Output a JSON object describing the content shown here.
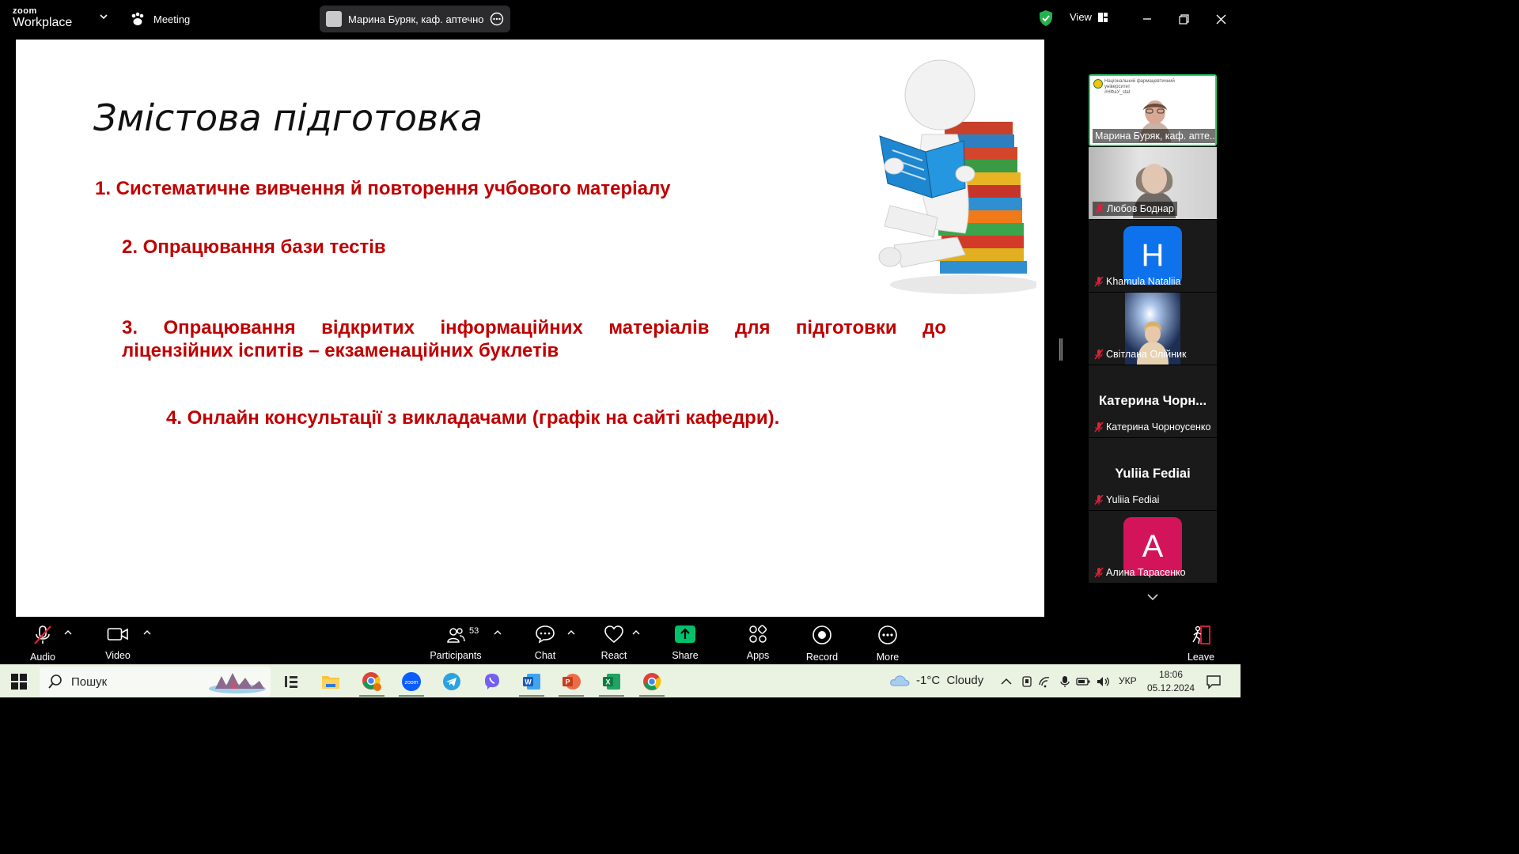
{
  "app": {
    "brand_line1": "zoom",
    "brand_line2": "Workplace",
    "meeting_label": "Meeting",
    "active_speaker": "Марина Буряк, каф. аптечної те",
    "view_label": "View",
    "security_color": "#22b14c"
  },
  "slide": {
    "title": "Змістова підготовка",
    "points": [
      "1. Систематичне вивчення й повторення учбового матеріалу",
      "2. Опрацювання бази тестів",
      "3. Опрацювання відкритих інформаційних матеріалів для підготовки до",
      "ліцензійних іспитів – екзаменаційних буклетів",
      "4. Онлайн консультації з викладачами (графік на сайті кафедри)."
    ],
    "text_color": "#c00000",
    "illustration": "reading-figure-with-books"
  },
  "participants": [
    {
      "name": "Марина Буряк, каф. апте...",
      "type": "video-speaking",
      "muted": false,
      "sub_text": "Національний фармацевтичний університет",
      "sub_text2": "#НФаУ_stat"
    },
    {
      "name": "Любов Боднар",
      "type": "video",
      "muted": true
    },
    {
      "name": "Khamula Nataliia",
      "type": "avatar",
      "initial": "H",
      "avatar_color": "#0e72ed",
      "muted": true
    },
    {
      "name": "Світлана Олійник",
      "type": "video",
      "muted": true
    },
    {
      "name": "Катерина Чорноусенко",
      "big_name": "Катерина Чорн...",
      "type": "name-only",
      "muted": true
    },
    {
      "name": "Yuliia Fediai",
      "big_name": "Yuliia Fediai",
      "type": "name-only",
      "muted": true
    },
    {
      "name": "Алина Тарасенко",
      "type": "avatar",
      "initial": "A",
      "avatar_color": "#d4145a",
      "muted": true
    }
  ],
  "toolbar": {
    "audio": "Audio",
    "video": "Video",
    "participants": "Participants",
    "participants_count": "53",
    "chat": "Chat",
    "react": "React",
    "share": "Share",
    "apps": "Apps",
    "record": "Record",
    "more": "More",
    "leave": "Leave",
    "share_color": "#00c26b",
    "mute_color": "#e0213a"
  },
  "taskbar": {
    "search_placeholder": "Пошук",
    "pinned_icons": [
      "task-view-icon",
      "file-explorer-icon",
      "chrome-profile-icon",
      "zoom-icon",
      "telegram-icon",
      "viber-icon",
      "word-icon",
      "powerpoint-icon",
      "excel-icon",
      "chrome-icon"
    ],
    "weather": "-1°C  Cloudy",
    "language": "УКР",
    "time": "18:06",
    "date": "05.12.2024"
  }
}
